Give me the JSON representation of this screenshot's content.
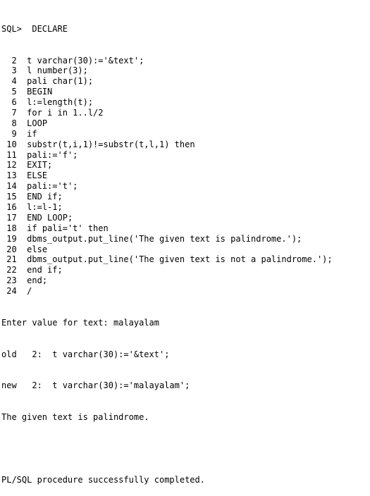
{
  "console": {
    "prompt": "SQL>",
    "header_code": "DECLARE",
    "lines": [
      {
        "num": "  2",
        "code": "t varchar(30):='&text';"
      },
      {
        "num": "  3",
        "code": "l number(3);"
      },
      {
        "num": "  4",
        "code": "pali char(1);"
      },
      {
        "num": "  5",
        "code": "BEGIN"
      },
      {
        "num": "  6",
        "code": "l:=length(t);"
      },
      {
        "num": "  7",
        "code": "for i in 1..l/2"
      },
      {
        "num": "  8",
        "code": "LOOP"
      },
      {
        "num": "  9",
        "code": "if"
      },
      {
        "num": " 10",
        "code": "substr(t,i,1)!=substr(t,l,1) then"
      },
      {
        "num": " 11",
        "code": "pali:='f';"
      },
      {
        "num": " 12",
        "code": "EXIT;"
      },
      {
        "num": " 13",
        "code": "ELSE"
      },
      {
        "num": " 14",
        "code": "pali:='t';"
      },
      {
        "num": " 15",
        "code": "END if;"
      },
      {
        "num": " 16",
        "code": "l:=l-1;"
      },
      {
        "num": " 17",
        "code": "END LOOP;"
      },
      {
        "num": " 18",
        "code": "if pali='t' then"
      },
      {
        "num": " 19",
        "code": "dbms_output.put_line('The given text is palindrome.');"
      },
      {
        "num": " 20",
        "code": "else"
      },
      {
        "num": " 21",
        "code": "dbms_output.put_line('The given text is not a palindrome.');"
      },
      {
        "num": " 22",
        "code": "end if;"
      },
      {
        "num": " 23",
        "code": "end;"
      },
      {
        "num": " 24",
        "code": "/"
      }
    ],
    "output": {
      "enter_value": "Enter value for text: malayalam",
      "old_line": "old   2:  t varchar(30):='&text';",
      "new_line": "new   2:  t varchar(30):='malayalam';",
      "result": "The given text is palindrome.",
      "completion": "PL/SQL procedure successfully completed."
    }
  }
}
